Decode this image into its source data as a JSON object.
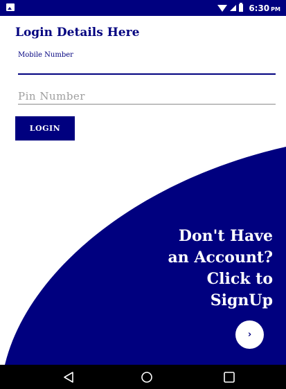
{
  "status_bar": {
    "time": "6:30",
    "ampm": "PM"
  },
  "title": "Login Details Here",
  "mobile": {
    "label": "Mobile Number",
    "value": ""
  },
  "pin": {
    "placeholder": "Pin Number",
    "value": ""
  },
  "login_button": "LOGIN",
  "signup": {
    "lines": [
      "Don't Have",
      "an Account?",
      "Click to",
      "SignUp"
    ],
    "arrow": "›"
  },
  "colors": {
    "primary": "#00007f",
    "background": "#ffffff",
    "nav": "#000000"
  },
  "icons": {
    "back": "back-icon",
    "home": "home-icon",
    "recents": "recents-icon"
  }
}
